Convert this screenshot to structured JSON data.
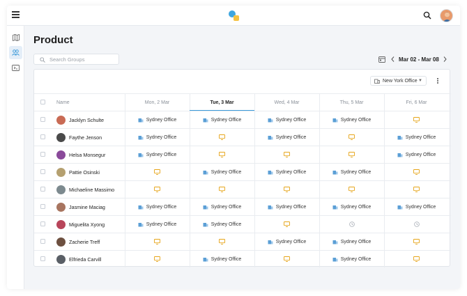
{
  "page": {
    "title": "Product"
  },
  "search": {
    "placeholder": "Search Groups"
  },
  "date_nav": {
    "range": "Mar 02 - Mar 08"
  },
  "filter": {
    "office": "New York Office"
  },
  "colors": {
    "accent": "#3b9ad9",
    "office_icon": "#5b9fd6",
    "remote_icon": "#e6a417",
    "logo_blue": "#3ea6e0",
    "logo_yellow": "#f5c242"
  },
  "table": {
    "name_header": "Name",
    "days": [
      "Mon, 2 Mar",
      "Tue, 3 Mar",
      "Wed, 4 Mar",
      "Thu, 5 Mar",
      "Fri, 6 Mar"
    ],
    "active_day": 1,
    "rows": [
      {
        "name": "Jacklyn Schulte",
        "avatar": "#c96b55",
        "days": [
          "Sydney Office",
          "Sydney Office",
          "Sydney Office",
          "Sydney Office",
          "remote"
        ]
      },
      {
        "name": "Faythe Jenson",
        "avatar": "#4a4a4a",
        "days": [
          "Sydney Office",
          "remote",
          "Sydney Office",
          "remote",
          "Sydney Office"
        ]
      },
      {
        "name": "Helsa Monsegur",
        "avatar": "#8a4a9a",
        "days": [
          "Sydney Office",
          "remote",
          "remote",
          "remote",
          "Sydney Office"
        ]
      },
      {
        "name": "Pattie Osinski",
        "avatar": "#b5a070",
        "days": [
          "remote",
          "Sydney Office",
          "Sydney Office",
          "Sydney Office",
          "remote"
        ]
      },
      {
        "name": "Michaeline Massimo",
        "avatar": "#7d8a8f",
        "days": [
          "remote",
          "remote",
          "remote",
          "remote",
          "remote"
        ]
      },
      {
        "name": "Jasmine Maciag",
        "avatar": "#a87560",
        "days": [
          "Sydney Office",
          "Sydney Office",
          "Sydney Office",
          "Sydney Office",
          "Sydney Office"
        ]
      },
      {
        "name": "Miguelita Xyong",
        "avatar": "#b8455a",
        "days": [
          "Sydney Office",
          "Sydney Office",
          "remote",
          "pending",
          "pending"
        ]
      },
      {
        "name": "Zacherie Treff",
        "avatar": "#6d5040",
        "days": [
          "remote",
          "remote",
          "Sydney Office",
          "Sydney Office",
          "remote"
        ]
      },
      {
        "name": "Elfrieda Carvill",
        "avatar": "#5a5f66",
        "days": [
          "remote",
          "Sydney Office",
          "remote",
          "Sydney Office",
          "remote"
        ]
      }
    ]
  },
  "icons": {
    "menu": "hamburger-icon",
    "search": "search-icon",
    "calendar": "calendar-icon",
    "office": "building-icon",
    "remote": "monitor-icon",
    "pending": "clock-icon"
  }
}
